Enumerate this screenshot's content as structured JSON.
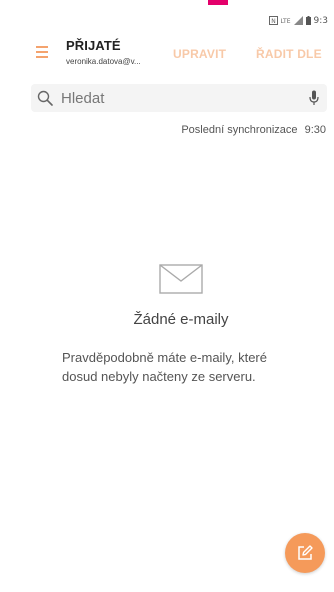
{
  "status_bar": {
    "time": "9:3",
    "icons": [
      "nfc-icon",
      "lte-icon",
      "signal-icon",
      "battery-icon"
    ],
    "lte_label": "LTE"
  },
  "header": {
    "folder_title": "PŘIJATÉ",
    "account_email": "veronika.datova@v...",
    "edit_label": "UPRAVIT",
    "sort_label": "ŘADIT DLE"
  },
  "search": {
    "placeholder": "Hledat"
  },
  "sync": {
    "label": "Poslední synchronizace",
    "time": "9:30"
  },
  "empty_state": {
    "title": "Žádné e-maily",
    "description": "Pravděpodobně máte e-maily, které dosud nebyly načteny ze serveru."
  },
  "colors": {
    "accent": "#f59a5a",
    "accent_light": "#f8c9a8",
    "top_marker": "#e3006b"
  }
}
